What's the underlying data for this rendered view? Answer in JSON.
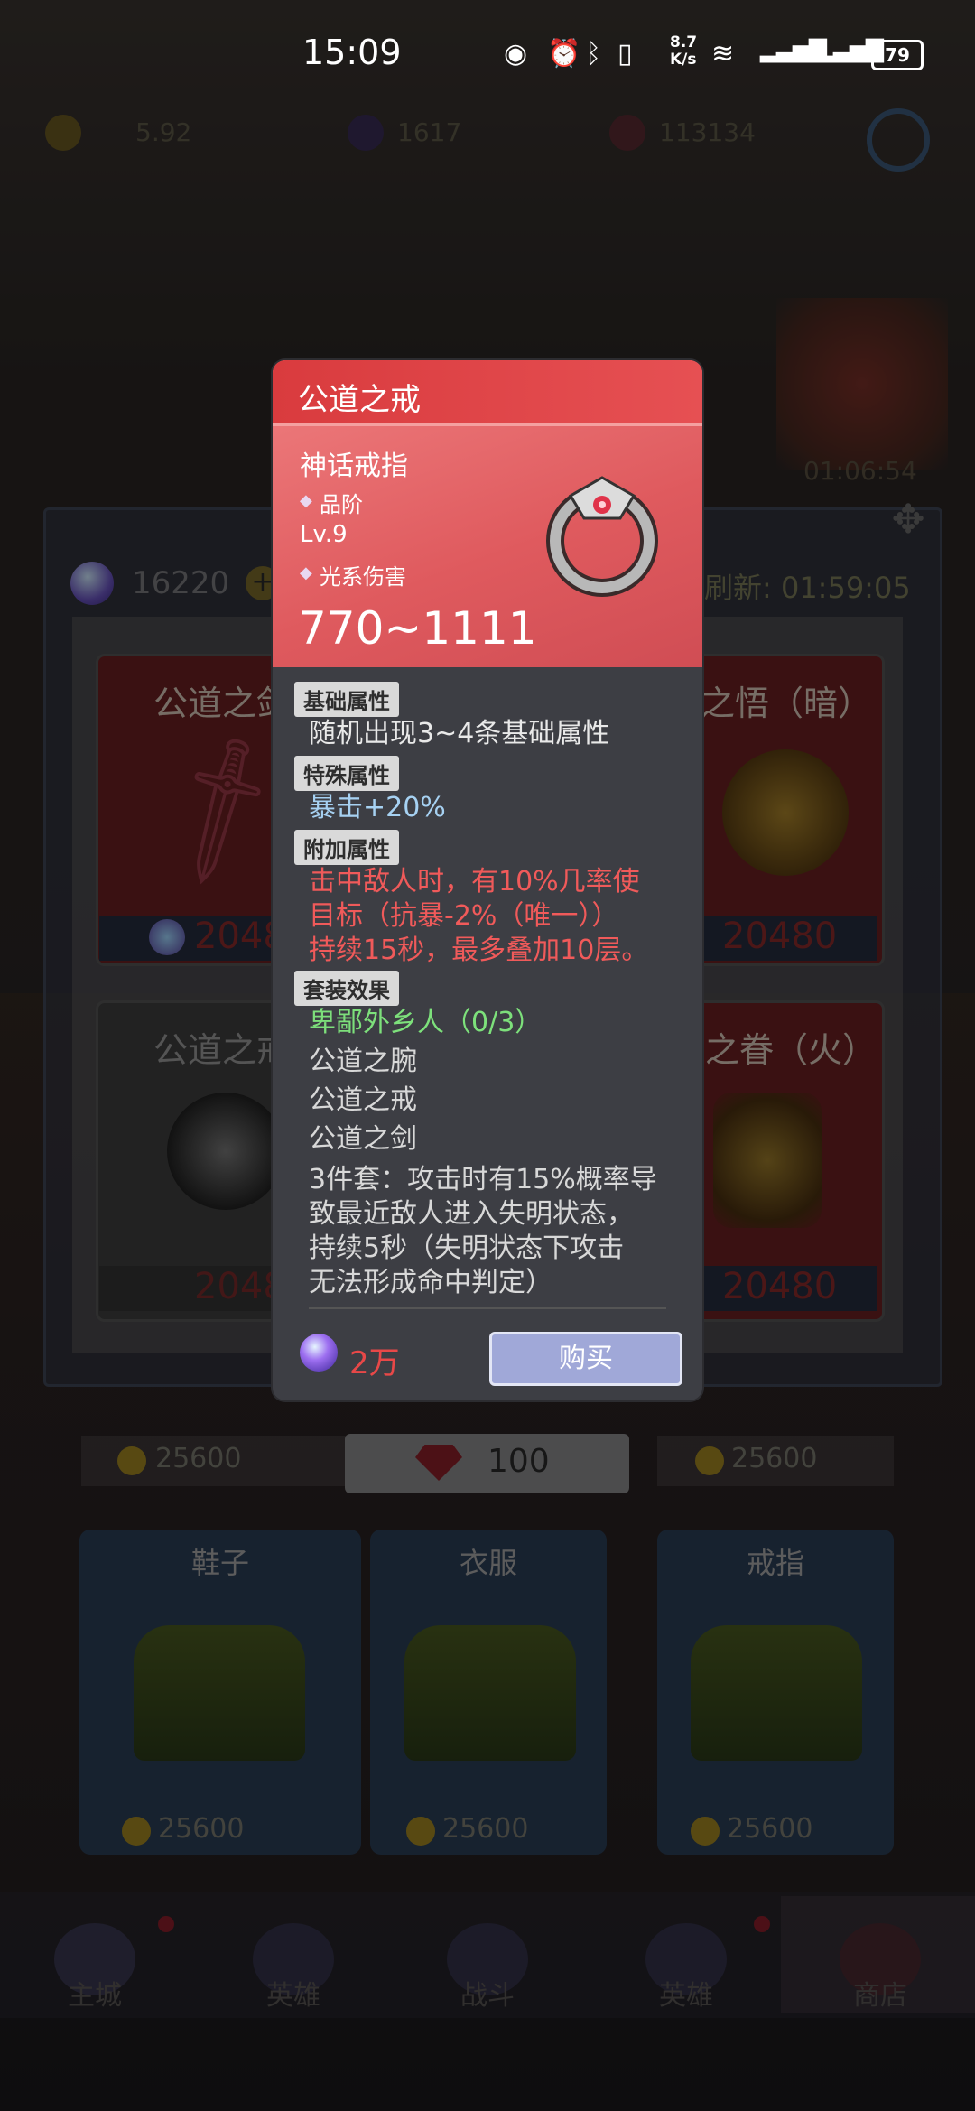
{
  "status_bar": {
    "time": "15:09",
    "net_speed": "8.7\nK/s",
    "battery": "79",
    "icons": [
      "eye-icon",
      "alarm-icon",
      "bluetooth-icon",
      "vibrate-icon",
      "wifi-icon",
      "signal-4g-icon",
      "signal-4g-icon-2"
    ]
  },
  "currency_bar": {
    "coins": "5.92",
    "crystals": "1617",
    "gems": "113134",
    "settings_icon": "gear-icon"
  },
  "shop": {
    "crystal_balance": "16220",
    "refresh_timer": "刷新: 01:59:05",
    "cards": [
      {
        "title": "公道之剑",
        "price": "2048"
      },
      {
        "title": "破灭之悟（暗）",
        "price": "20480"
      },
      {
        "title": "公道之戒",
        "price": "2048"
      },
      {
        "title": "荣誉之眷（火）",
        "price": "20480"
      }
    ],
    "row_prices": [
      "25600",
      "25600"
    ],
    "gem_cost": "100",
    "chests": [
      {
        "label": "鞋子",
        "price": "25600"
      },
      {
        "label": "衣服",
        "price": "25600"
      },
      {
        "label": "戒指",
        "price": "25600"
      }
    ],
    "event_timer": "01:06:54"
  },
  "nav": {
    "items": [
      "主城",
      "英雄",
      "战斗",
      "英雄",
      "商店"
    ]
  },
  "popup": {
    "title": "公道之戒",
    "subtype": "神话戒指",
    "quality_label": "品阶",
    "level": "Lv.9",
    "element": "光系伤害",
    "damage_range": "770~1111",
    "sections": {
      "basic_tag": "基础属性",
      "basic_text": "随机出现3~4条基础属性",
      "special_tag": "特殊属性",
      "special_text": "暴击+20%",
      "extra_tag": "附加属性",
      "extra_text_1": "击中敌人时，有10%几率使",
      "extra_text_2": "目标（抗暴-2%（唯一））",
      "extra_text_3": "持续15秒，最多叠加10层。",
      "set_tag": "套装效果",
      "set_name": "卑鄙外乡人（0/3）",
      "set_item_1": "公道之腕",
      "set_item_2": "公道之戒",
      "set_item_3": "公道之剑",
      "set_bonus_1": "3件套：攻击时有15%概率导",
      "set_bonus_2": "致最近敌人进入失明状态，",
      "set_bonus_3": "持续5秒（失明状态下攻击",
      "set_bonus_4": "无法形成命中判定）"
    },
    "price": "2万",
    "buy_label": "购买"
  }
}
